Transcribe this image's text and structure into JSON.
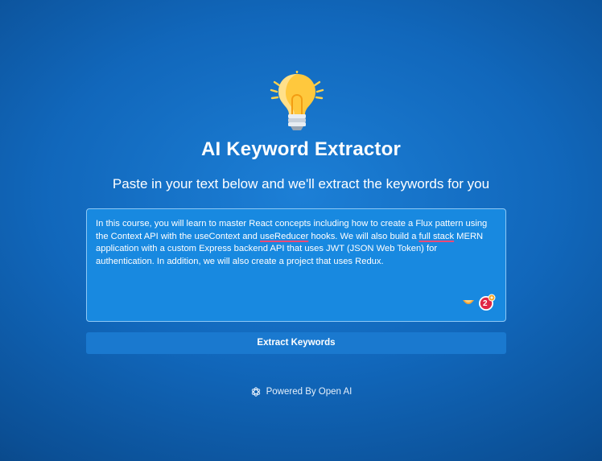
{
  "header": {
    "logo_icon": "lightbulb-icon",
    "title": "AI Keyword Extractor",
    "subtitle": "Paste in your text below and we'll extract the keywords for you"
  },
  "input": {
    "text_part_1": "In this course, you will learn to master React concepts including how to create a Flux pattern using the Context API with the useContext and ",
    "misspelled_1": "useReducer",
    "text_part_2": " hooks. We will also build a ",
    "misspelled_2": "full stack",
    "text_part_3": " MERN application with a custom Express backend API that uses JWT (JSON Web Token) for authentication. In addition, we will also create a project that uses Redux.",
    "extension_badge_count": "2"
  },
  "actions": {
    "extract_label": "Extract Keywords"
  },
  "footer": {
    "powered_by": "Powered By Open AI",
    "logo_icon": "openai-logo-icon"
  },
  "colors": {
    "background": "#1167bb",
    "textarea_bg": "#1889e0",
    "button_bg": "#1a79cf",
    "bulb_yellow": "#ffd24d",
    "spellcheck_underline": "#f04a76"
  }
}
